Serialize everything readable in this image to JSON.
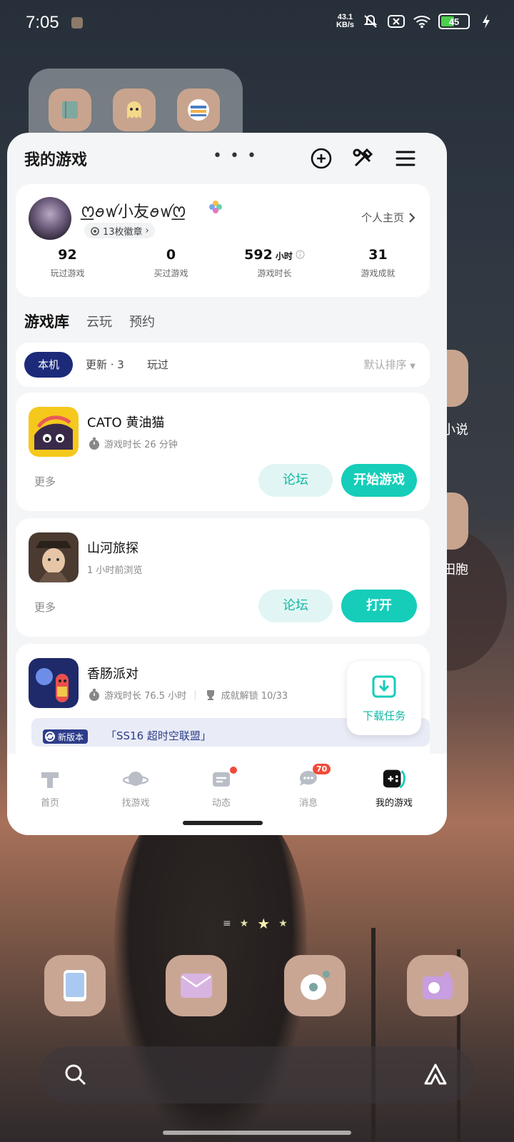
{
  "status_bar": {
    "time": "7:05",
    "net_speed_value": "43.1",
    "net_speed_unit": "KB/s",
    "battery": "45"
  },
  "side_apps": {
    "label_1": "小说",
    "label_2": "田胞"
  },
  "app": {
    "title": "我的游戏",
    "menu_dots": "• • •"
  },
  "profile": {
    "nickname": "ꯁ꯭ꪮꪝ小友ꪮꪝꯁ꯭",
    "badges": "13枚徽章",
    "homepage_link": "个人主页",
    "stats": [
      {
        "value": "92",
        "unit": "",
        "label": "玩过游戏"
      },
      {
        "value": "0",
        "unit": "",
        "label": "买过游戏"
      },
      {
        "value": "592",
        "unit": "小时",
        "label": "游戏时长"
      },
      {
        "value": "31",
        "unit": "",
        "label": "游戏成就"
      }
    ]
  },
  "library_tabs": [
    "游戏库",
    "云玩",
    "预约"
  ],
  "filters": {
    "chips": [
      "本机",
      "更新 · 3",
      "玩过"
    ],
    "sort": "默认排序"
  },
  "games": [
    {
      "name": "CATO 黄油猫",
      "meta": "游戏时长 26 分钟",
      "more": "更多",
      "forum": "论坛",
      "primary": "开始游戏"
    },
    {
      "name": "山河旅探",
      "meta": "1 小时前浏览",
      "more": "更多",
      "forum": "论坛",
      "primary": "打开"
    },
    {
      "name": "香肠派对",
      "meta": "游戏时长 76.5 小时",
      "achievement": "成就解锁 10/33",
      "news_tag": "新版本",
      "news_text": "「SS16 超时空联盟」"
    }
  ],
  "download_task": "下载任务",
  "bottom_nav": [
    {
      "label": "首页",
      "icon": "home-icon"
    },
    {
      "label": "找游戏",
      "icon": "planet-icon"
    },
    {
      "label": "动态",
      "icon": "feed-icon"
    },
    {
      "label": "消息",
      "icon": "message-icon",
      "badge": "70"
    },
    {
      "label": "我的游戏",
      "icon": "gamepad-icon"
    }
  ],
  "colors": {
    "accent": "#15cdb9",
    "accent_light": "#e1f6f4",
    "chip_active": "#1c2a7a",
    "badge_red": "#f04a3a"
  }
}
